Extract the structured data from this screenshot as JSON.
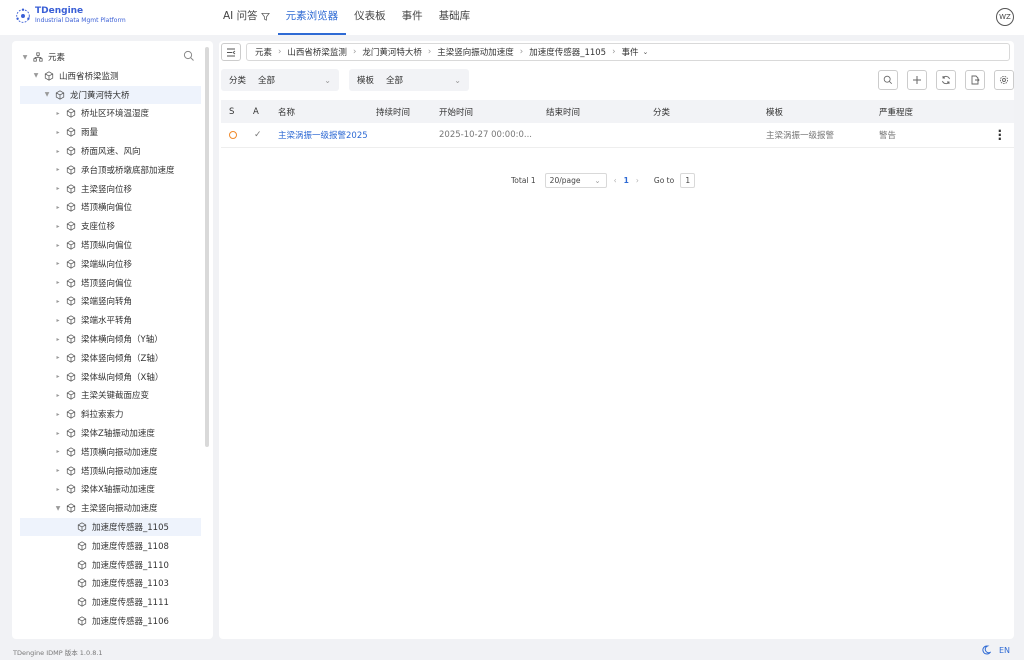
{
  "brand": {
    "title": "TDengine",
    "subtitle": "Industrial Data Mgmt Platform"
  },
  "nav": [
    {
      "label": "AI 问答",
      "icon": "filter-icon"
    },
    {
      "label": "元素浏览器",
      "active": true
    },
    {
      "label": "仪表板"
    },
    {
      "label": "事件"
    },
    {
      "label": "基础库"
    }
  ],
  "user": {
    "initials": "WZ"
  },
  "sidebar": {
    "root": "元素",
    "items": [
      {
        "label": "山西省桥梁监测"
      },
      {
        "label": "龙门黄河特大桥"
      },
      {
        "label": "桥址区环境温湿度"
      },
      {
        "label": "雨量"
      },
      {
        "label": "桥面风速、风向"
      },
      {
        "label": "承台顶或桥墩底部加速度"
      },
      {
        "label": "主梁竖向位移"
      },
      {
        "label": "塔顶横向偏位"
      },
      {
        "label": "支座位移"
      },
      {
        "label": "塔顶纵向偏位"
      },
      {
        "label": "梁端纵向位移"
      },
      {
        "label": "塔顶竖向偏位"
      },
      {
        "label": "梁端竖向转角"
      },
      {
        "label": "梁端水平转角"
      },
      {
        "label": "梁体横向倾角（Y轴）"
      },
      {
        "label": "梁体竖向倾角（Z轴）"
      },
      {
        "label": "梁体纵向倾角（X轴）"
      },
      {
        "label": "主梁关键截面应变"
      },
      {
        "label": "斜拉索索力"
      },
      {
        "label": "梁体Z轴振动加速度"
      },
      {
        "label": "塔顶横向振动加速度"
      },
      {
        "label": "塔顶纵向振动加速度"
      },
      {
        "label": "梁体X轴振动加速度"
      },
      {
        "label": "主梁竖向振动加速度"
      },
      {
        "label": "加速度传感器_1105"
      },
      {
        "label": "加速度传感器_1108"
      },
      {
        "label": "加速度传感器_1110"
      },
      {
        "label": "加速度传感器_1103"
      },
      {
        "label": "加速度传感器_1111"
      },
      {
        "label": "加速度传感器_1106"
      }
    ]
  },
  "breadcrumb": [
    "元素",
    "山西省桥梁监测",
    "龙门黄河特大桥",
    "主梁竖向振动加速度",
    "加速度传感器_1105",
    "事件"
  ],
  "filters": {
    "category_label": "分类",
    "category_value": "全部",
    "template_label": "模板",
    "template_value": "全部"
  },
  "table": {
    "headers": [
      "S",
      "A",
      "名称",
      "持续时间",
      "开始时间",
      "结束时间",
      "分类",
      "模板",
      "严重程度"
    ],
    "rows": [
      {
        "name": "主梁涡振一级报警2025",
        "duration": "",
        "start": "2025-10-27 00:00:0...",
        "end": "",
        "category": "",
        "template": "主梁涡振一级报警",
        "severity": "警告"
      }
    ]
  },
  "pager": {
    "total": "Total 1",
    "size": "20/page",
    "page": "1",
    "goto_label": "Go to",
    "goto_value": "1"
  },
  "footer": {
    "version": "TDengine IDMP 版本 1.0.8.1",
    "lang": "EN"
  }
}
